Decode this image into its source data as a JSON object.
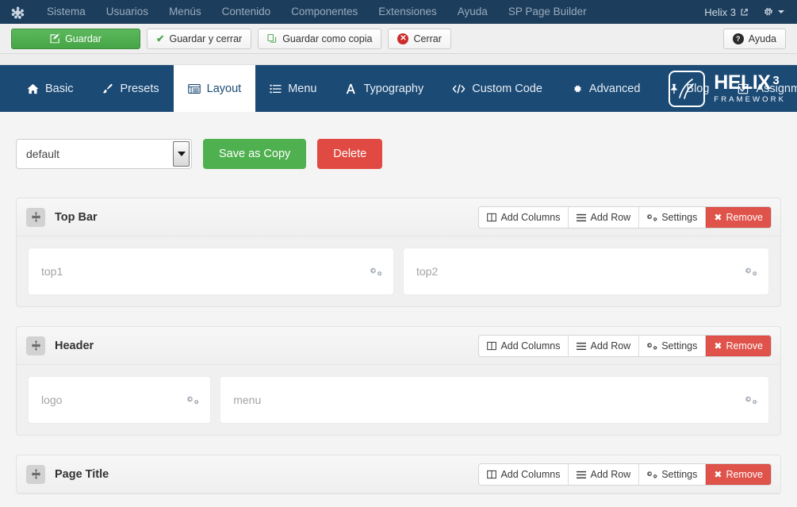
{
  "admin_bar": {
    "logo_icon": "joomla-logo-icon",
    "menu": [
      {
        "label": "Sistema"
      },
      {
        "label": "Usuarios"
      },
      {
        "label": "Menús"
      },
      {
        "label": "Contenido"
      },
      {
        "label": "Componentes"
      },
      {
        "label": "Extensiones"
      },
      {
        "label": "Ayuda"
      },
      {
        "label": "SP Page Builder"
      }
    ],
    "site_link": "Helix 3",
    "site_link_icon": "external-link-icon",
    "gear_icon": "gear-icon",
    "bg_color": "#1c3d5c"
  },
  "toolbar": {
    "save_label": "Guardar",
    "save_close_label": "Guardar y cerrar",
    "save_copy_label": "Guardar como copia",
    "close_label": "Cerrar",
    "help_label": "Ayuda",
    "save_color": "#5cb85c"
  },
  "helix_nav": {
    "tabs": [
      {
        "label": "Basic",
        "icon": "home-icon",
        "active": false
      },
      {
        "label": "Presets",
        "icon": "brush-icon",
        "active": false
      },
      {
        "label": "Layout",
        "icon": "layout-icon",
        "active": true
      },
      {
        "label": "Menu",
        "icon": "list-icon",
        "active": false
      },
      {
        "label": "Typography",
        "icon": "font-icon",
        "active": false
      },
      {
        "label": "Custom Code",
        "icon": "code-icon",
        "active": false
      },
      {
        "label": "Advanced",
        "icon": "gear-icon",
        "active": false
      },
      {
        "label": "Blog",
        "icon": "pin-icon",
        "active": false
      },
      {
        "label": "Assignment",
        "icon": "checkbox-icon",
        "active": false
      }
    ],
    "brand_name": "HELIX",
    "brand_version": "3",
    "brand_sub": "FRAMEWORK",
    "bg_color": "#1b4a75"
  },
  "preset_bar": {
    "select_value": "default",
    "select_options": [
      "default"
    ],
    "save_as_copy_label": "Save as Copy",
    "delete_label": "Delete",
    "save_copy_color": "#4fb04f",
    "delete_color": "#e04a42"
  },
  "row_actions": {
    "add_columns_label": "Add Columns",
    "add_row_label": "Add Row",
    "settings_label": "Settings",
    "remove_label": "Remove",
    "remove_color": "#e0534b"
  },
  "sections": [
    {
      "title": "Top Bar",
      "columns": [
        {
          "label": "top1",
          "width": "50%"
        },
        {
          "label": "top2",
          "width": "50%"
        }
      ]
    },
    {
      "title": "Header",
      "columns": [
        {
          "label": "logo",
          "width": "25%"
        },
        {
          "label": "menu",
          "width": "75%"
        }
      ]
    },
    {
      "title": "Page Title",
      "columns": []
    }
  ]
}
